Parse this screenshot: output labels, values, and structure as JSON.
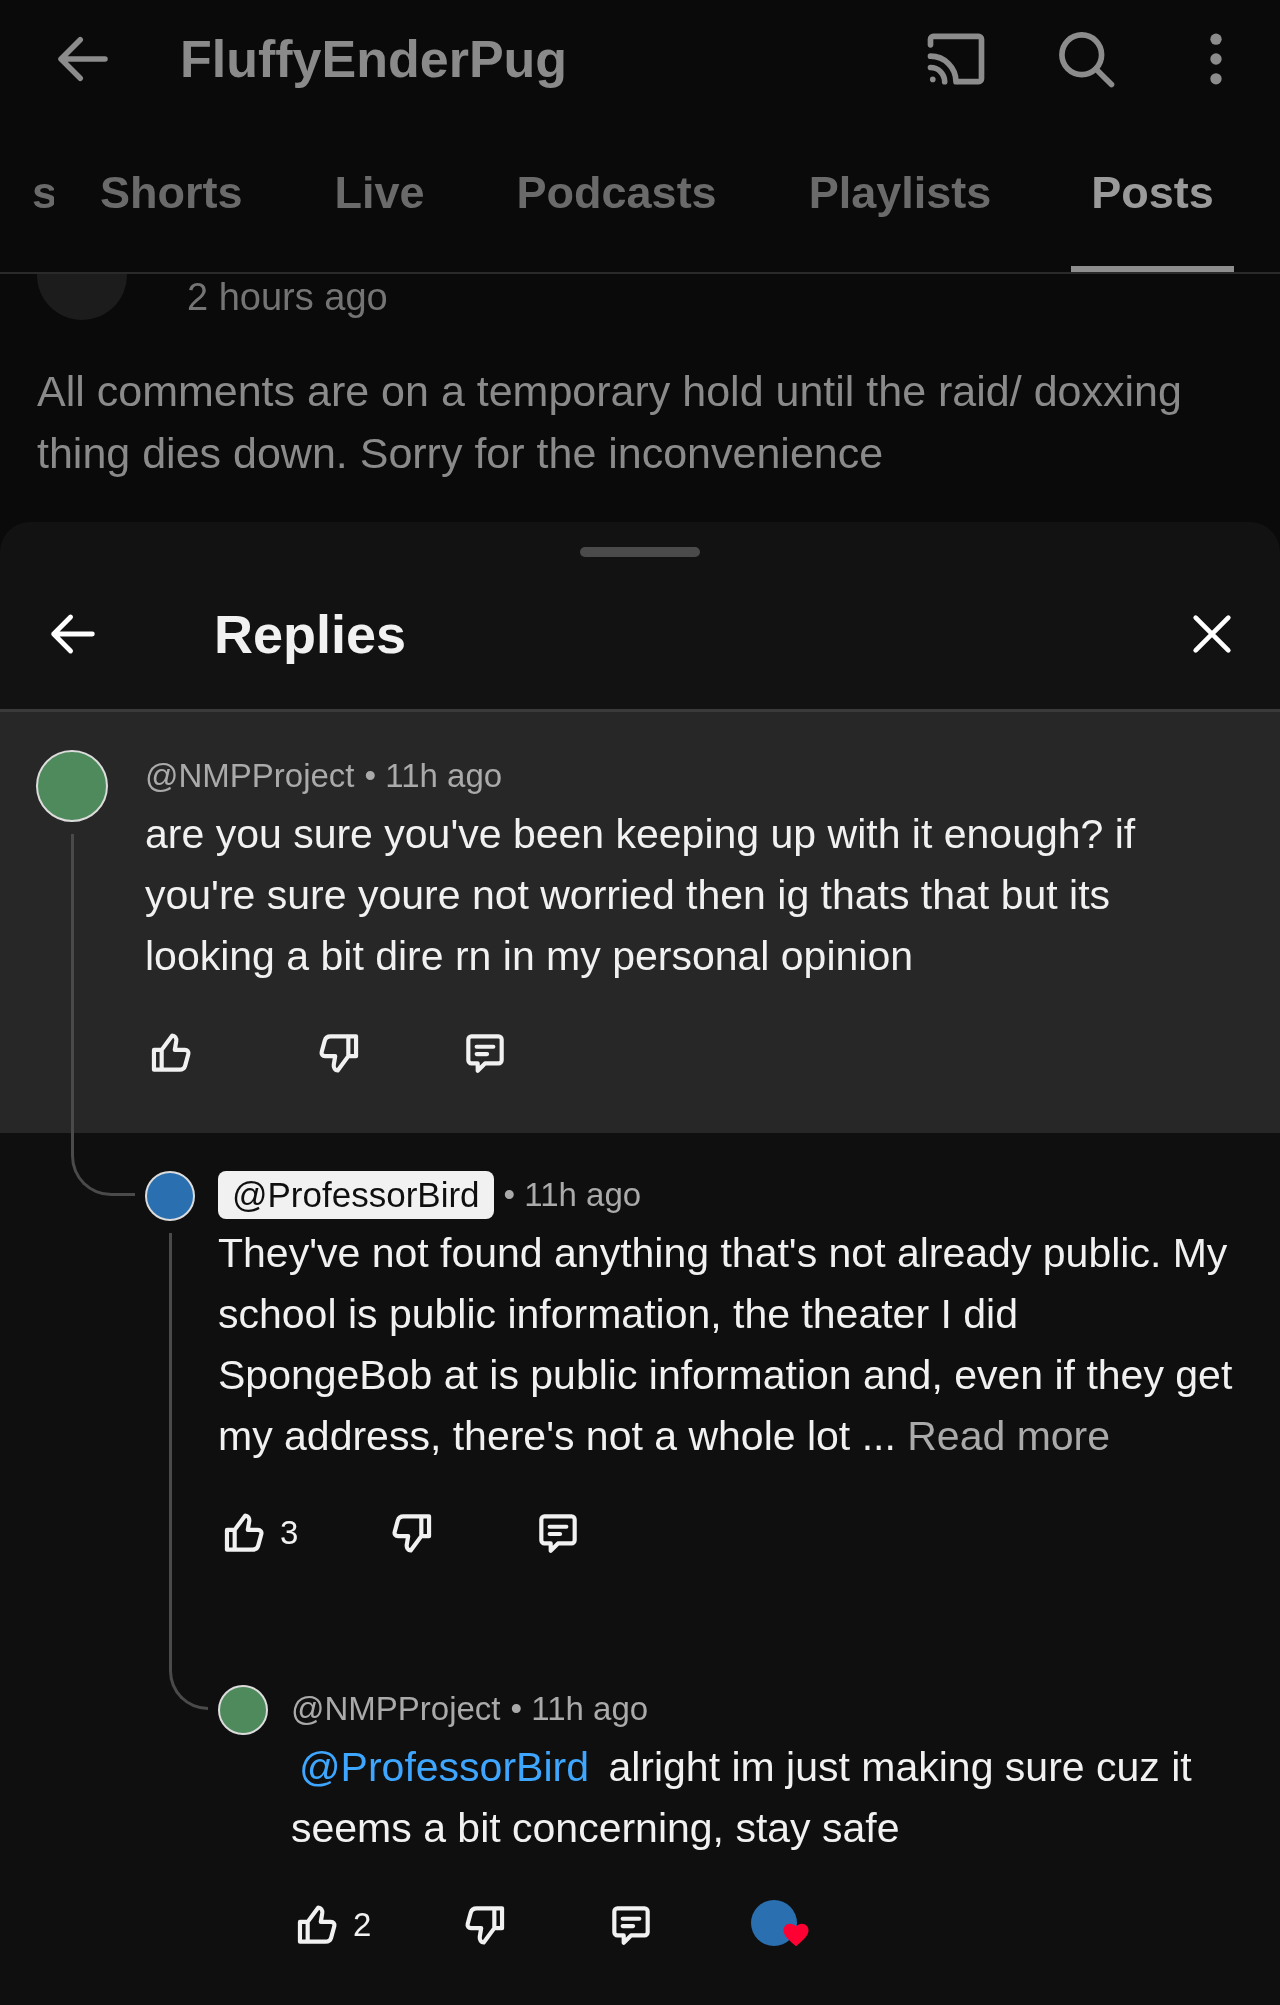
{
  "header": {
    "title": "FluffyEnderPug"
  },
  "tabs": [
    {
      "label": "s",
      "selected": false
    },
    {
      "label": "Shorts",
      "selected": false
    },
    {
      "label": "Live",
      "selected": false
    },
    {
      "label": "Podcasts",
      "selected": false
    },
    {
      "label": "Playlists",
      "selected": false
    },
    {
      "label": "Posts",
      "selected": true
    }
  ],
  "post": {
    "time": "2 hours ago",
    "text": "All comments are on a temporary hold until the raid/ doxxing thing dies down. Sorry for the inconvenience"
  },
  "replies": {
    "title": "Replies",
    "comments": [
      {
        "author": "@NMPProject",
        "author_highlighted": false,
        "time": "• 11h ago",
        "color": "#4f8a5c",
        "highlighted": true,
        "text": "are you sure you've been keeping up with it enough? if you're sure youre not worried then ig thats that but its looking a bit dire rn in my personal opinion",
        "creator_heart": false,
        "children": [
          {
            "author": "@ProfessorBird",
            "author_highlighted": true,
            "time": "• 11h ago",
            "color": "#2a6fb0",
            "highlighted": false,
            "text": "They've not found anything that's not already public. My school is public information, the theater I did SpongeBob at is public information and, even if they get my address, there's not a whole lot ...",
            "read_more": "Read more",
            "likes": "3",
            "creator_heart": false,
            "children": [
              {
                "author": "@NMPProject",
                "author_highlighted": false,
                "time": "• 11h ago",
                "color": "#4f8a5c",
                "highlighted": false,
                "mention": "@ProfessorBird",
                "text": "alright im just making sure cuz it seems a bit concerning, stay safe",
                "likes": "2",
                "creator_heart": true
              }
            ]
          }
        ]
      }
    ]
  }
}
